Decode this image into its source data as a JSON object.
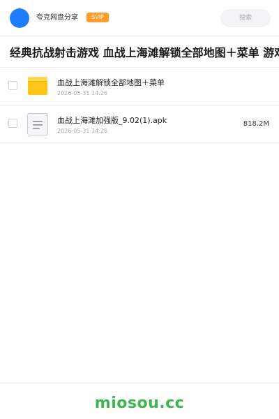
{
  "colors": {
    "brand": "#1f7bff",
    "accent": "#ff9e2c",
    "folder": "#ffc61a",
    "footer": "#3fb550"
  },
  "header": {
    "app_name": "夸克网盘分享",
    "badge": "SVIP",
    "search_placeholder": "搜索"
  },
  "share": {
    "title": "经典抗战射击游戏 血战上海滩解锁全部地图＋菜单 游戏秘籍"
  },
  "files": [
    {
      "name": "血战上海滩解锁全部地图＋菜单",
      "date": "2026-05-31 14:26",
      "size": "",
      "icon": "folder-icon"
    },
    {
      "name": "血战上海滩加强版_9.02(1).apk",
      "date": "2026-05-31 14:26",
      "size": "818.2M",
      "icon": "file-icon"
    }
  ],
  "footer": {
    "brand": "miosou.cc"
  }
}
